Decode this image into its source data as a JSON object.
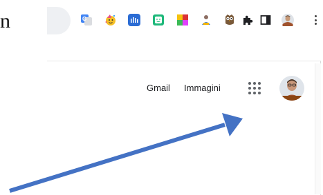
{
  "page": {
    "edge_letter": "n"
  },
  "toolbar": {
    "extensions": [
      {
        "icon": "translate-extension-icon"
      },
      {
        "icon": "party-face-extension-icon"
      },
      {
        "icon": "wave-bars-extension-icon"
      },
      {
        "icon": "smile-card-extension-icon"
      },
      {
        "icon": "color-palette-extension-icon"
      },
      {
        "icon": "bookmark-person-extension-icon"
      },
      {
        "icon": "owl-extension-icon"
      },
      {
        "icon": "puzzle-extensions-icon"
      },
      {
        "icon": "side-panel-icon"
      },
      {
        "icon": "profile-avatar-icon"
      },
      {
        "icon": "more-menu-icon"
      }
    ]
  },
  "header": {
    "gmail_label": "Gmail",
    "images_label": "Immagini",
    "apps_icon": "google-apps-grid-icon",
    "account_icon": "account-avatar"
  },
  "annotation": {
    "type": "arrow",
    "color": "#4472c4",
    "points_to": "google-apps-grid-icon"
  }
}
